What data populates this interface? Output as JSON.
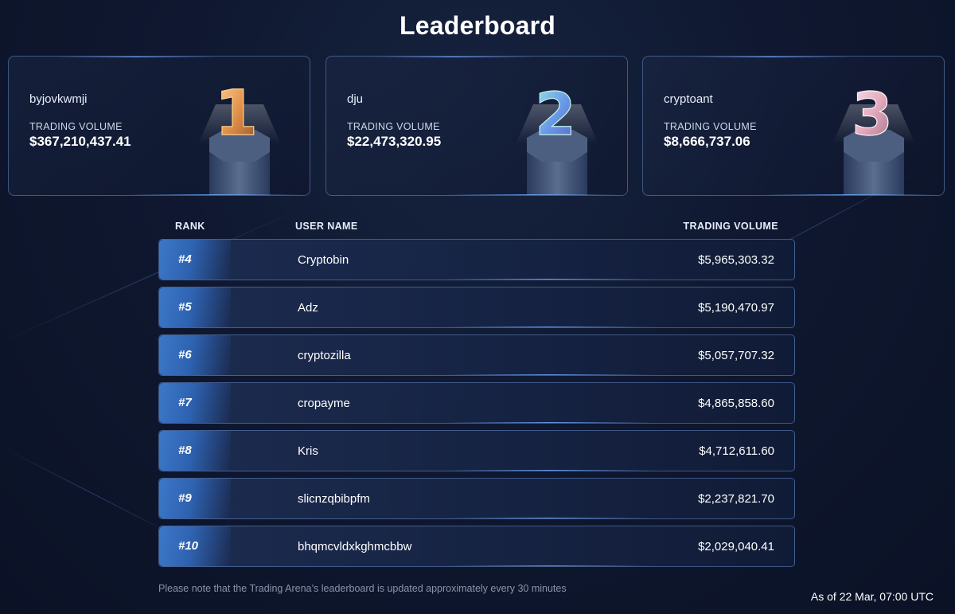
{
  "page": {
    "title": "Leaderboard"
  },
  "podium": [
    {
      "rank_icon": "trophy-1-icon",
      "username": "byjovkwmji",
      "volume_label": "TRADING VOLUME",
      "volume": "$367,210,437.41",
      "accent": "#f0a862"
    },
    {
      "rank_icon": "trophy-2-icon",
      "username": "dju",
      "volume_label": "TRADING VOLUME",
      "volume": "$22,473,320.95",
      "accent": "#7fb0f0"
    },
    {
      "rank_icon": "trophy-3-icon",
      "username": "cryptoant",
      "volume_label": "TRADING VOLUME",
      "volume": "$8,666,737.06",
      "accent": "#e8b6c8"
    }
  ],
  "table": {
    "headers": {
      "rank": "RANK",
      "user": "USER NAME",
      "volume": "TRADING VOLUME"
    },
    "rows": [
      {
        "rank": "#4",
        "user": "Cryptobin",
        "volume": "$5,965,303.32"
      },
      {
        "rank": "#5",
        "user": "Adz",
        "volume": "$5,190,470.97"
      },
      {
        "rank": "#6",
        "user": "cryptozilla",
        "volume": "$5,057,707.32"
      },
      {
        "rank": "#7",
        "user": "cropayme",
        "volume": "$4,865,858.60"
      },
      {
        "rank": "#8",
        "user": "Kris",
        "volume": "$4,712,611.60"
      },
      {
        "rank": "#9",
        "user": "slicnzqbibpfm",
        "volume": "$2,237,821.70"
      },
      {
        "rank": "#10",
        "user": "bhqmcvldxkghmcbbw",
        "volume": "$2,029,040.41"
      }
    ]
  },
  "footer": {
    "note": "Please note that the Trading Arena’s leaderboard is updated approximately every 30 minutes",
    "timestamp": "As of 22 Mar, 07:00 UTC"
  },
  "colors": {
    "background": "#0f1830",
    "rank_accent": "#3c78c8",
    "border": "#5a7fc0"
  }
}
